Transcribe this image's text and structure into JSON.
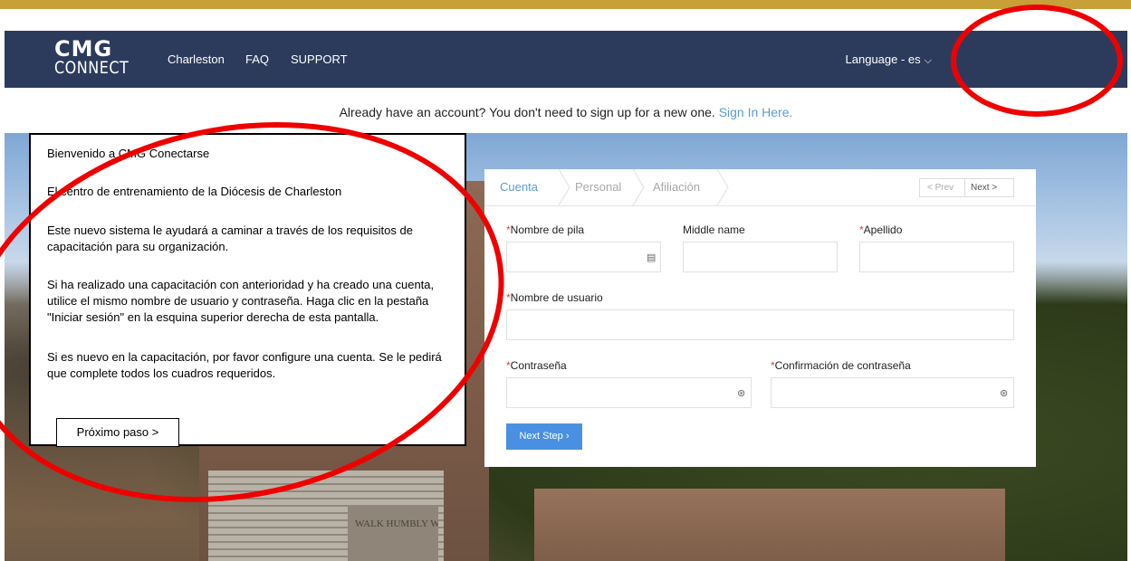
{
  "nav": {
    "logo_line1": "CMG",
    "logo_line2": "CONNECT",
    "links": [
      "Charleston",
      "FAQ",
      "SUPPORT"
    ],
    "language": "Language - es",
    "language_chevron": "⌵"
  },
  "signin_bar": {
    "text": "Already have an account? You don't need to sign up for a new one.",
    "link": "Sign In Here."
  },
  "welcome": {
    "title": "Bienvenido a CMG Conectarse",
    "para1": "El centro de entrenamiento de la Diócesis de Charleston",
    "para2": "Este nuevo sistema le ayudará a caminar a través de los requisitos de capacitación para su organización.",
    "para3": "Si ha realizado una capacitación con anterioridad y ha creado una cuenta, utilice el mismo nombre de usuario y contraseña. Haga clic en la pestaña \"Iniciar sesión\" en la esquina superior derecha de esta pantalla.",
    "para4": "Si es nuevo en la capacitación, por favor configure una cuenta. Se le pedirá que complete todos los cuadros  requeridos.",
    "next_button": "Próximo paso >"
  },
  "form": {
    "tabs": [
      "Cuenta",
      "Personal",
      "Afiliación"
    ],
    "active_tab": "Cuenta",
    "pager_prev": "< Prev",
    "pager_next": "Next >",
    "fields": {
      "first_name": "Nombre de pila",
      "middle_name": "Middle name",
      "last_name": "Apellido",
      "username": "Nombre de usuario",
      "password": "Contraseña",
      "password_confirm": "Confirmación de contraseña"
    },
    "required_mark": "*",
    "next_step": "Next Step ›"
  },
  "photo": {
    "sign_text": "WALK HUMBLY WITH YOUR GOD"
  },
  "colors": {
    "nav_bg": "#2c3b5c",
    "accent": "#5b9bd5",
    "button": "#4a90e2",
    "annotation": "#ef0000",
    "top_line": "#c7a037"
  }
}
